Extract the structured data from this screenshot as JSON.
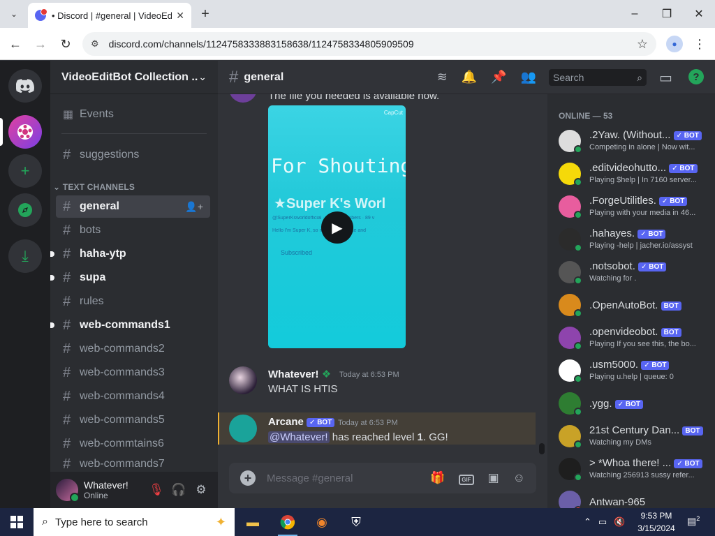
{
  "browser": {
    "tab_title": "• Discord | #general | VideoEdit",
    "url": "discord.com/channels/1124758333883158638/1124758334805909509",
    "window_controls": [
      "–",
      "❐",
      "✕"
    ]
  },
  "server": {
    "name": "VideoEditBot Collection ...",
    "events_label": "Events",
    "suggestions_label": "suggestions",
    "category_label": "TEXT CHANNELS",
    "channels": [
      {
        "name": "general"
      },
      {
        "name": "bots"
      },
      {
        "name": "haha-ytp"
      },
      {
        "name": "supa"
      },
      {
        "name": "rules"
      },
      {
        "name": "web-commands1"
      },
      {
        "name": "web-commands2"
      },
      {
        "name": "web-commands3"
      },
      {
        "name": "web-commands4"
      },
      {
        "name": "web-commands5"
      },
      {
        "name": "web-commtains6"
      },
      {
        "name": "web-commands7"
      }
    ]
  },
  "user_panel": {
    "name": "Whatever!",
    "status": "Online"
  },
  "channel": {
    "name": "general",
    "search_placeholder": "Search"
  },
  "messages": {
    "top_text": "The file you needed is available now.",
    "video": {
      "title": "For Shouting",
      "subtitle": "Super K's Worl",
      "line1": "@SuperKsworldofficial · 89K subscribers · 89 v",
      "line2": "Hello I'm Super K, so make sure to like and",
      "line3": "Subscribed",
      "watermark": "CapCut"
    },
    "msg1": {
      "author": "Whatever!",
      "timestamp": "Today at 6:53 PM",
      "body": "WHAT IS HTIS"
    },
    "msg2": {
      "author": "Arcane",
      "bot_tag": "✓ BOT",
      "timestamp": "Today at 6:53 PM",
      "mention": "@Whatever!",
      "body_pre": " has reached level ",
      "level": "1",
      "body_post": ". GG!"
    }
  },
  "composer": {
    "placeholder": "Message #general"
  },
  "members": {
    "header": "ONLINE — 53",
    "list": [
      {
        "name": ".2Yaw. (Without...",
        "tag": "✓ BOT",
        "activity": "Competing in alone | Now wit...",
        "color": "#ddd"
      },
      {
        "name": ".editvideohutto...",
        "tag": "✓ BOT",
        "activity": "Playing $help | In 7160 server...",
        "color": "#f5d90a"
      },
      {
        "name": ".ForgeUtilitles.",
        "tag": "✓ BOT",
        "activity": "Playing with your media in 46...",
        "color": "#e85d9e"
      },
      {
        "name": ".hahayes.",
        "tag": "✓ BOT",
        "activity": "Playing -help | jacher.io/assyst",
        "color": "#2b2b2b"
      },
      {
        "name": ".notsobot.",
        "tag": "✓ BOT",
        "activity": "Watching for .",
        "color": "#555"
      },
      {
        "name": ".OpenAutoBot.",
        "tag": "BOT",
        "activity": "",
        "color": "#d98a1c"
      },
      {
        "name": ".openvideobot.",
        "tag": "BOT",
        "activity": "Playing If you see this, the bo...",
        "color": "#8e44ad"
      },
      {
        "name": ".usm5000.",
        "tag": "✓ BOT",
        "activity": "Playing u.help | queue: 0",
        "color": "#fff"
      },
      {
        "name": ".ygg.",
        "tag": "✓ BOT",
        "activity": "",
        "color": "#2e7d32"
      },
      {
        "name": "21st Century Dan...",
        "tag": "BOT",
        "activity": "Watching my DMs",
        "color": "#c9a227"
      },
      {
        "name": "> *Whoa there! ...",
        "tag": "✓ BOT",
        "activity": "Watching 256913 sussy refer...",
        "color": "#1e1e1e"
      },
      {
        "name": "Antwan-965",
        "tag": "",
        "activity": "",
        "color": "#6b5fa8"
      }
    ]
  },
  "taskbar": {
    "search_placeholder": "Type here to search",
    "time": "9:53 PM",
    "date": "3/15/2024",
    "notification_count": "2"
  }
}
